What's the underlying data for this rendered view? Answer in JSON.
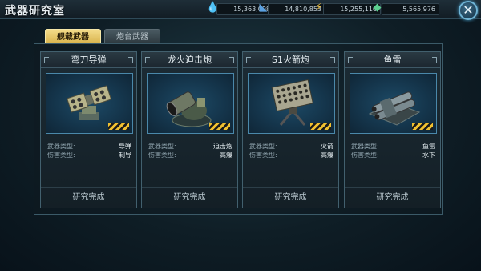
{
  "window": {
    "title": "武器研究室"
  },
  "resources": [
    {
      "name": "fuel",
      "icon": "purple-drop-icon",
      "value": "15,363,098",
      "color": "#9b6ad6"
    },
    {
      "name": "steel",
      "icon": "blue-plate-icon",
      "value": "14,810,853",
      "color": "#5aa0e0"
    },
    {
      "name": "ammo",
      "icon": "gold-bolt-icon",
      "value": "15,255,116",
      "color": "#e8c040"
    },
    {
      "name": "alloy",
      "icon": "green-crystal-icon",
      "value": "5,565,976",
      "color": "#5cd090"
    }
  ],
  "tabs": [
    {
      "label": "舰载武器",
      "active": true
    },
    {
      "label": "炮台武器",
      "active": false
    }
  ],
  "stat_labels": {
    "weapon_type": "武器类型:",
    "damage_type": "伤害类型:"
  },
  "cards": [
    {
      "name": "弯刀导弹",
      "weapon_type": "导弹",
      "damage_type": "制导",
      "status": "研究完成",
      "image": "missile-launcher-icon"
    },
    {
      "name": "龙火迫击炮",
      "weapon_type": "迫击炮",
      "damage_type": "高爆",
      "status": "研究完成",
      "image": "mortar-icon"
    },
    {
      "name": "S1火箭炮",
      "weapon_type": "火箭",
      "damage_type": "高爆",
      "status": "研究完成",
      "image": "rocket-launcher-icon"
    },
    {
      "name": "鱼雷",
      "weapon_type": "鱼雷",
      "damage_type": "水下",
      "status": "研究完成",
      "image": "torpedo-launcher-icon"
    }
  ]
}
